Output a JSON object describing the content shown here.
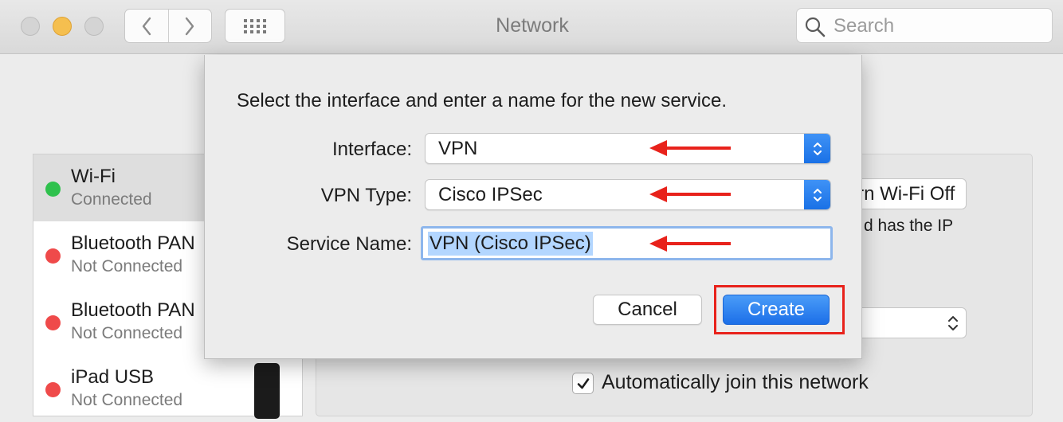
{
  "window": {
    "title": "Network",
    "search_placeholder": "Search"
  },
  "sidebar": {
    "services": [
      {
        "name": "Wi-Fi",
        "status": "Connected",
        "status_color": "#2fc14d"
      },
      {
        "name": "Bluetooth PAN",
        "status": "Not Connected",
        "status_color": "#ef4a4a"
      },
      {
        "name": "Bluetooth PAN",
        "status": "Not Connected",
        "status_color": "#ef4a4a"
      },
      {
        "name": "iPad USB",
        "status": "Not Connected",
        "status_color": "#ef4a4a"
      }
    ]
  },
  "detail": {
    "wifi_button_label": "Turn Wi-Fi Off",
    "status_text": "d has the IP",
    "auto_join_label": "Automatically join this network",
    "auto_join_checked": true
  },
  "sheet": {
    "prompt": "Select the interface and enter a name for the new service.",
    "interface_label": "Interface:",
    "interface_value": "VPN",
    "vpn_type_label": "VPN Type:",
    "vpn_type_value": "Cisco IPSec",
    "service_name_label": "Service Name:",
    "service_name_value": "VPN (Cisco IPSec)",
    "cancel_label": "Cancel",
    "create_label": "Create"
  },
  "colors": {
    "accent": "#1c6fe8",
    "annotation": "#e8221b"
  }
}
